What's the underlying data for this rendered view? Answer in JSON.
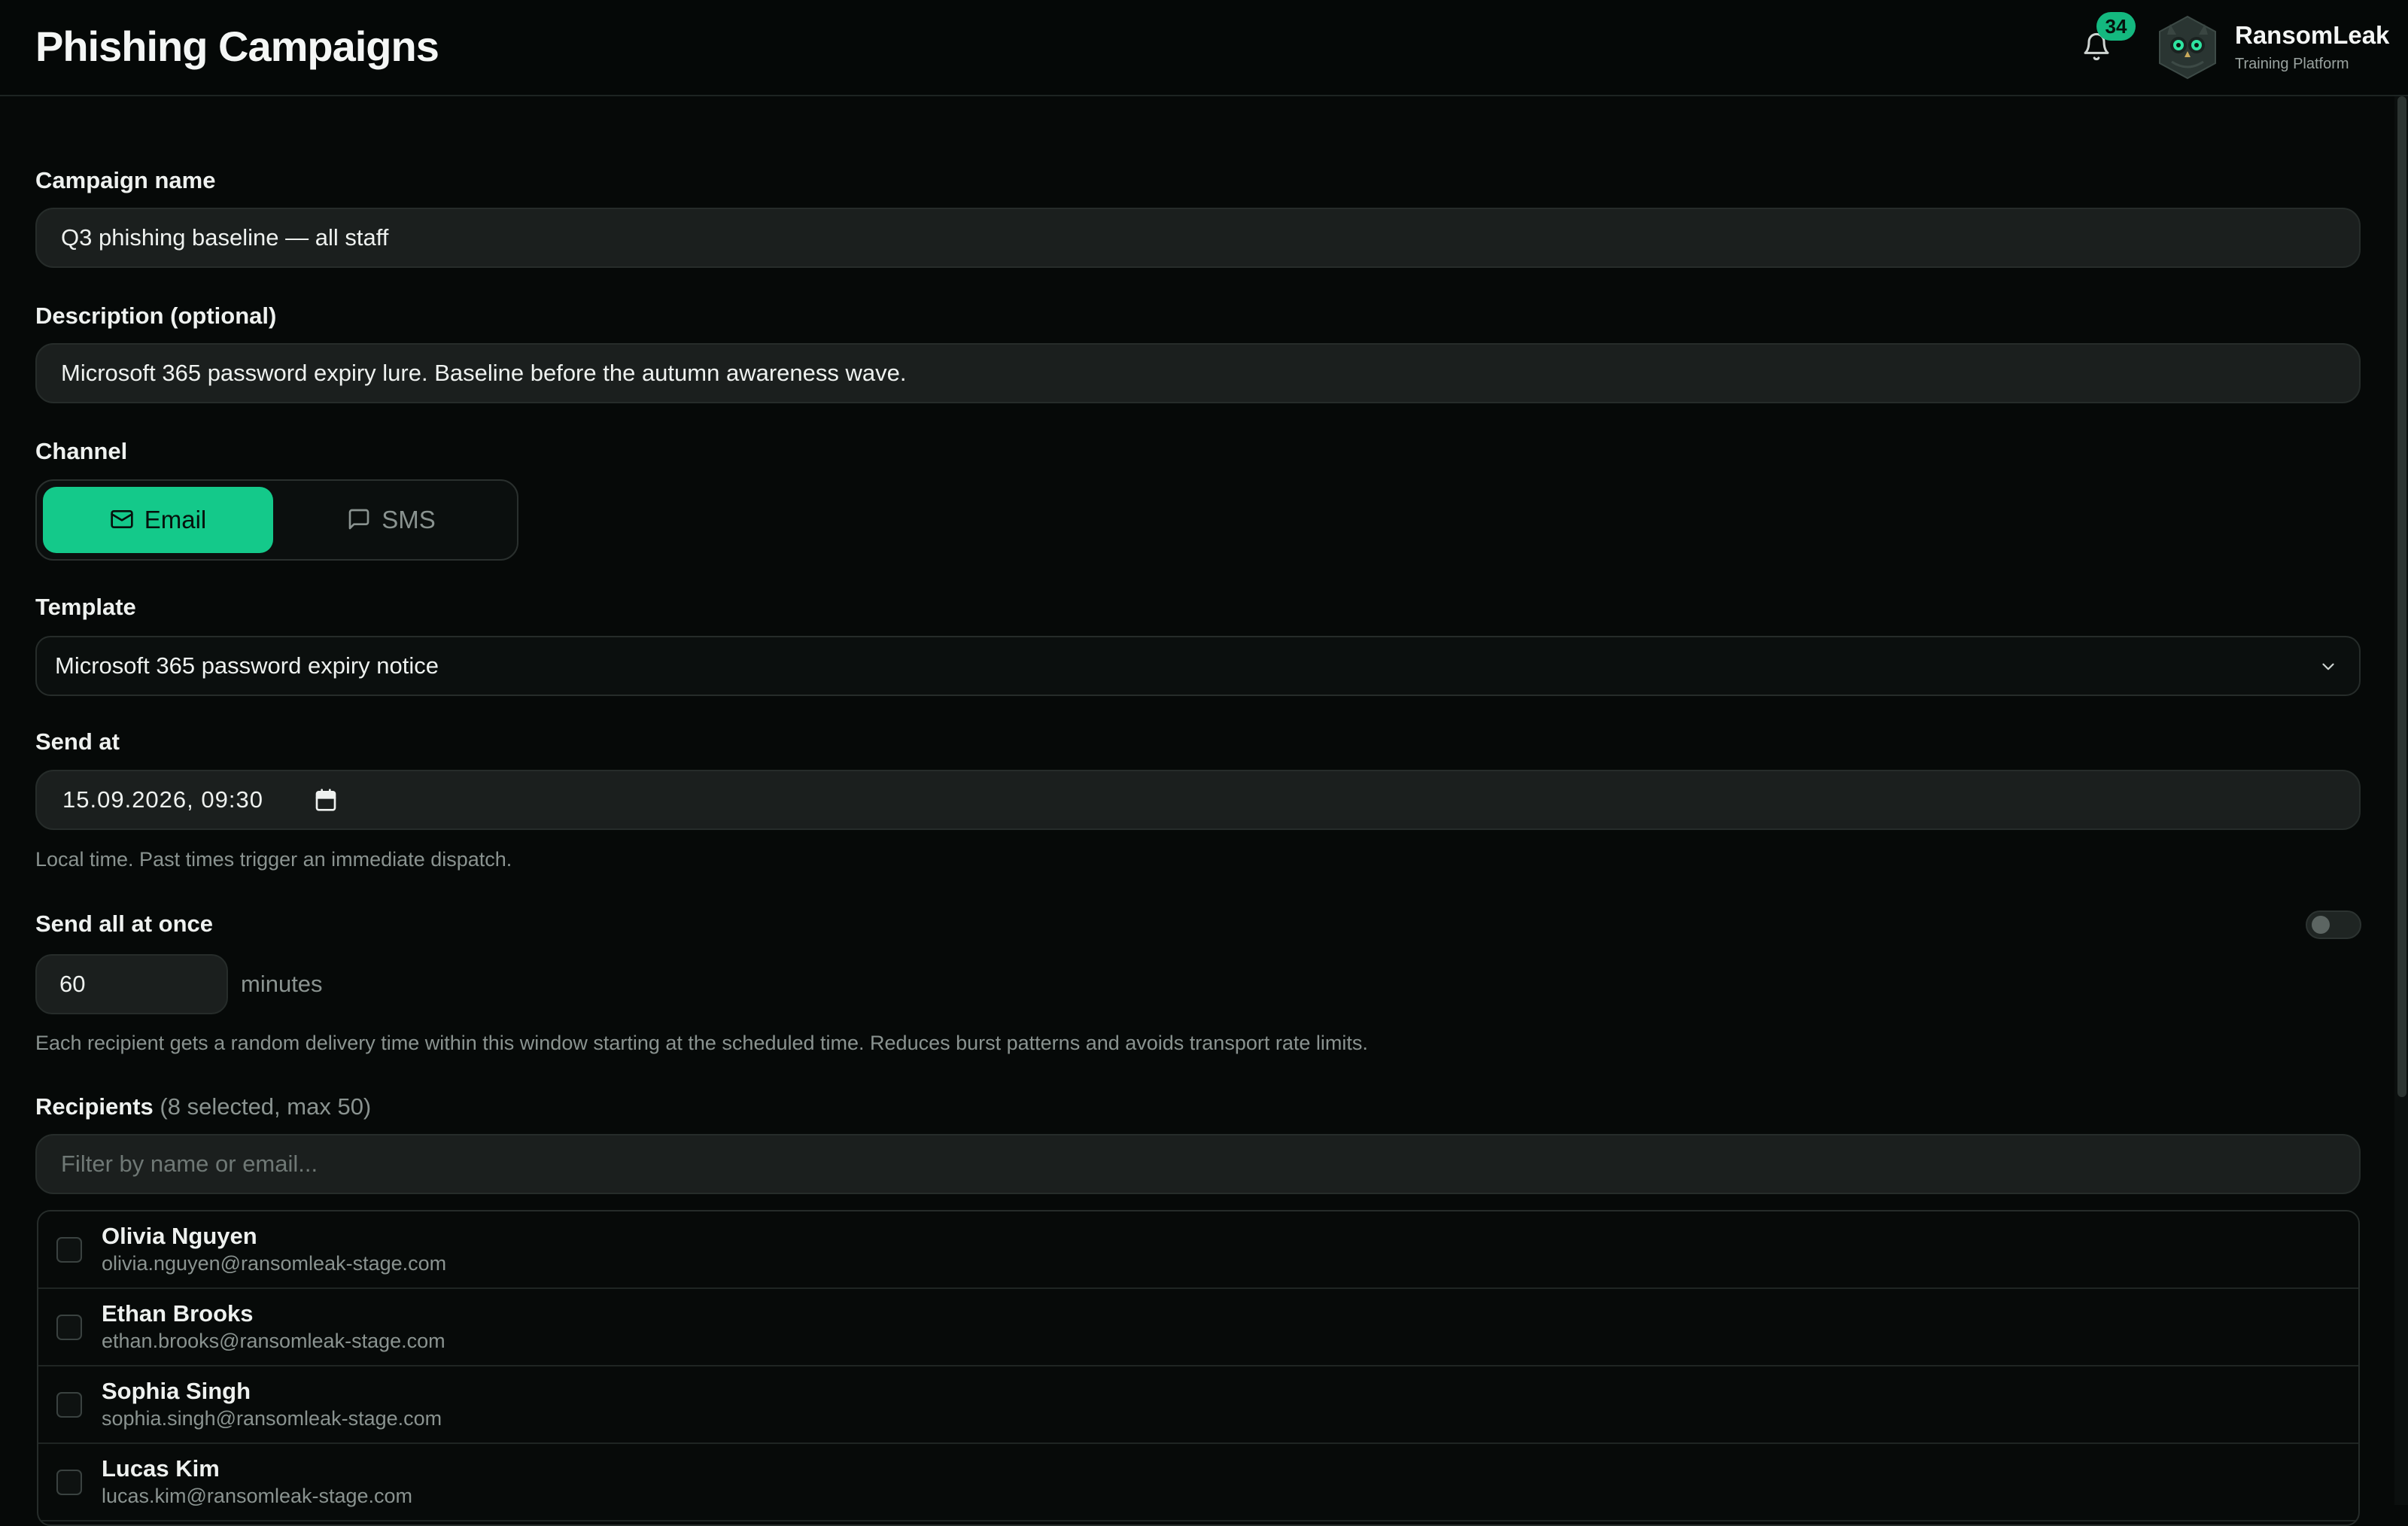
{
  "header": {
    "title": "Phishing Campaigns",
    "notification_count": "34",
    "brand_name": "RansomLeak",
    "brand_subtitle": "Training Platform"
  },
  "form": {
    "campaign_name": {
      "label": "Campaign name",
      "value": "Q3 phishing baseline — all staff"
    },
    "description": {
      "label": "Description (optional)",
      "value": "Microsoft 365 password expiry lure. Baseline before the autumn awareness wave."
    },
    "channel": {
      "label": "Channel",
      "options": [
        {
          "label": "Email",
          "icon": "mail-icon",
          "selected": true
        },
        {
          "label": "SMS",
          "icon": "message-icon",
          "selected": false
        }
      ]
    },
    "template": {
      "label": "Template",
      "value": "Microsoft 365 password expiry notice"
    },
    "send_at": {
      "label": "Send at",
      "value": "15.09.2026, 09:30",
      "hint": "Local time. Past times trigger an immediate dispatch."
    },
    "send_all_at_once": {
      "label": "Send all at once",
      "enabled": false,
      "window_value": "60",
      "window_unit": "minutes",
      "hint": "Each recipient gets a random delivery time within this window starting at the scheduled time. Reduces burst patterns and avoids transport rate limits."
    },
    "recipients": {
      "label": "Recipients",
      "count_text": "(8 selected, max 50)",
      "filter_placeholder": "Filter by name or email...",
      "items": [
        {
          "name": "Olivia Nguyen",
          "email": "olivia.nguyen@ransomleak-stage.com",
          "checked": false
        },
        {
          "name": "Ethan Brooks",
          "email": "ethan.brooks@ransomleak-stage.com",
          "checked": false
        },
        {
          "name": "Sophia Singh",
          "email": "sophia.singh@ransomleak-stage.com",
          "checked": false
        },
        {
          "name": "Lucas Kim",
          "email": "lucas.kim@ransomleak-stage.com",
          "checked": false
        }
      ]
    }
  },
  "colors": {
    "accent": "#14c98a",
    "background": "#060908",
    "field_bg": "#1b1f1e",
    "muted_text": "#8a9390"
  }
}
